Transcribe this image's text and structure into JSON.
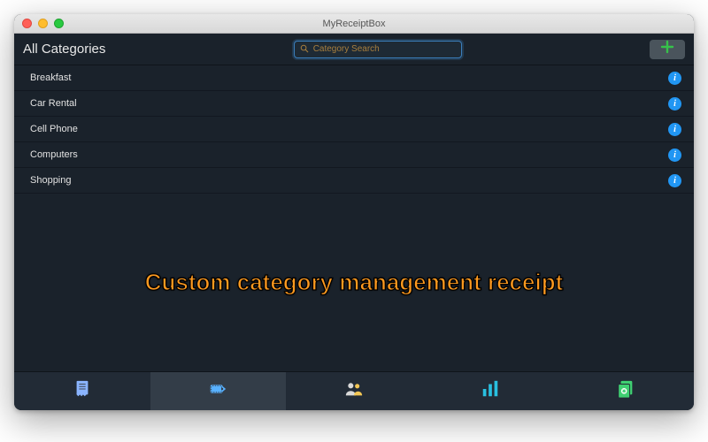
{
  "window": {
    "title": "MyReceiptBox"
  },
  "toolbar": {
    "heading": "All Categories",
    "search_placeholder": "Category Search"
  },
  "categories": [
    {
      "name": "Breakfast"
    },
    {
      "name": "Car Rental"
    },
    {
      "name": "Cell Phone"
    },
    {
      "name": "Computers"
    },
    {
      "name": "Shopping"
    }
  ],
  "caption": "Custom category management receipt",
  "tabs": {
    "active_index": 1
  }
}
